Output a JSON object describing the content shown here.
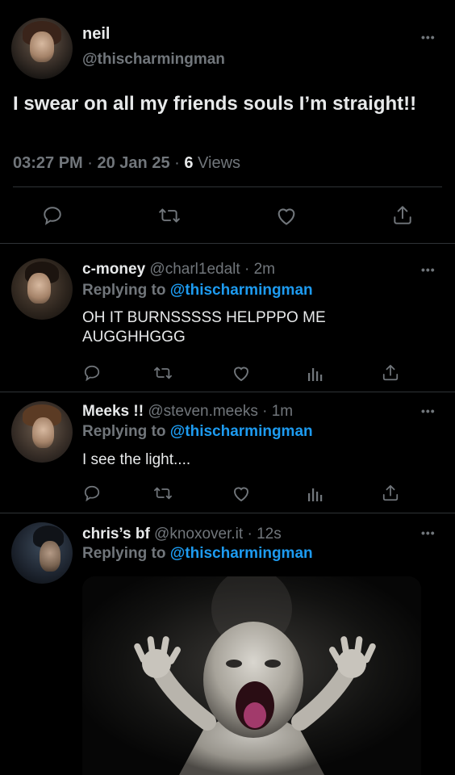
{
  "main_tweet": {
    "display_name": "neil",
    "handle": "@thischarmingman",
    "text": "I swear on all my friends souls I’m straight!!",
    "time": "03:27 PM",
    "date": "20 Jan 25",
    "views_count": "6",
    "views_label": "Views",
    "more_label": "•••"
  },
  "replies": [
    {
      "display_name": "c-money",
      "handle": "@charl1edalt",
      "time": "2m",
      "replying_prefix": "Replying to",
      "replying_handle": "@thischarmingman",
      "text": "OH IT BURNSSSSS HELPPPO ME AUGGHHGGG"
    },
    {
      "display_name": "Meeks !!",
      "handle": "@steven.meeks",
      "time": "1m",
      "replying_prefix": "Replying to",
      "replying_handle": "@thischarmingman",
      "text": "I see the light...."
    },
    {
      "display_name": "chris’s bf",
      "handle": "@knoxover.it",
      "time": "12s",
      "replying_prefix": "Replying to",
      "replying_handle": "@thischarmingman",
      "media": "screaming-baby-image"
    }
  ],
  "separator": " · ",
  "icons": {
    "reply": "reply-icon",
    "retweet": "retweet-icon",
    "like": "heart-icon",
    "views": "views-chart-icon",
    "share": "share-icon",
    "more": "more-dots-icon"
  },
  "colors": {
    "background": "#000000",
    "text": "#e7e9ea",
    "muted": "#71767b",
    "link": "#1d9bf0",
    "divider": "#2f3336"
  }
}
